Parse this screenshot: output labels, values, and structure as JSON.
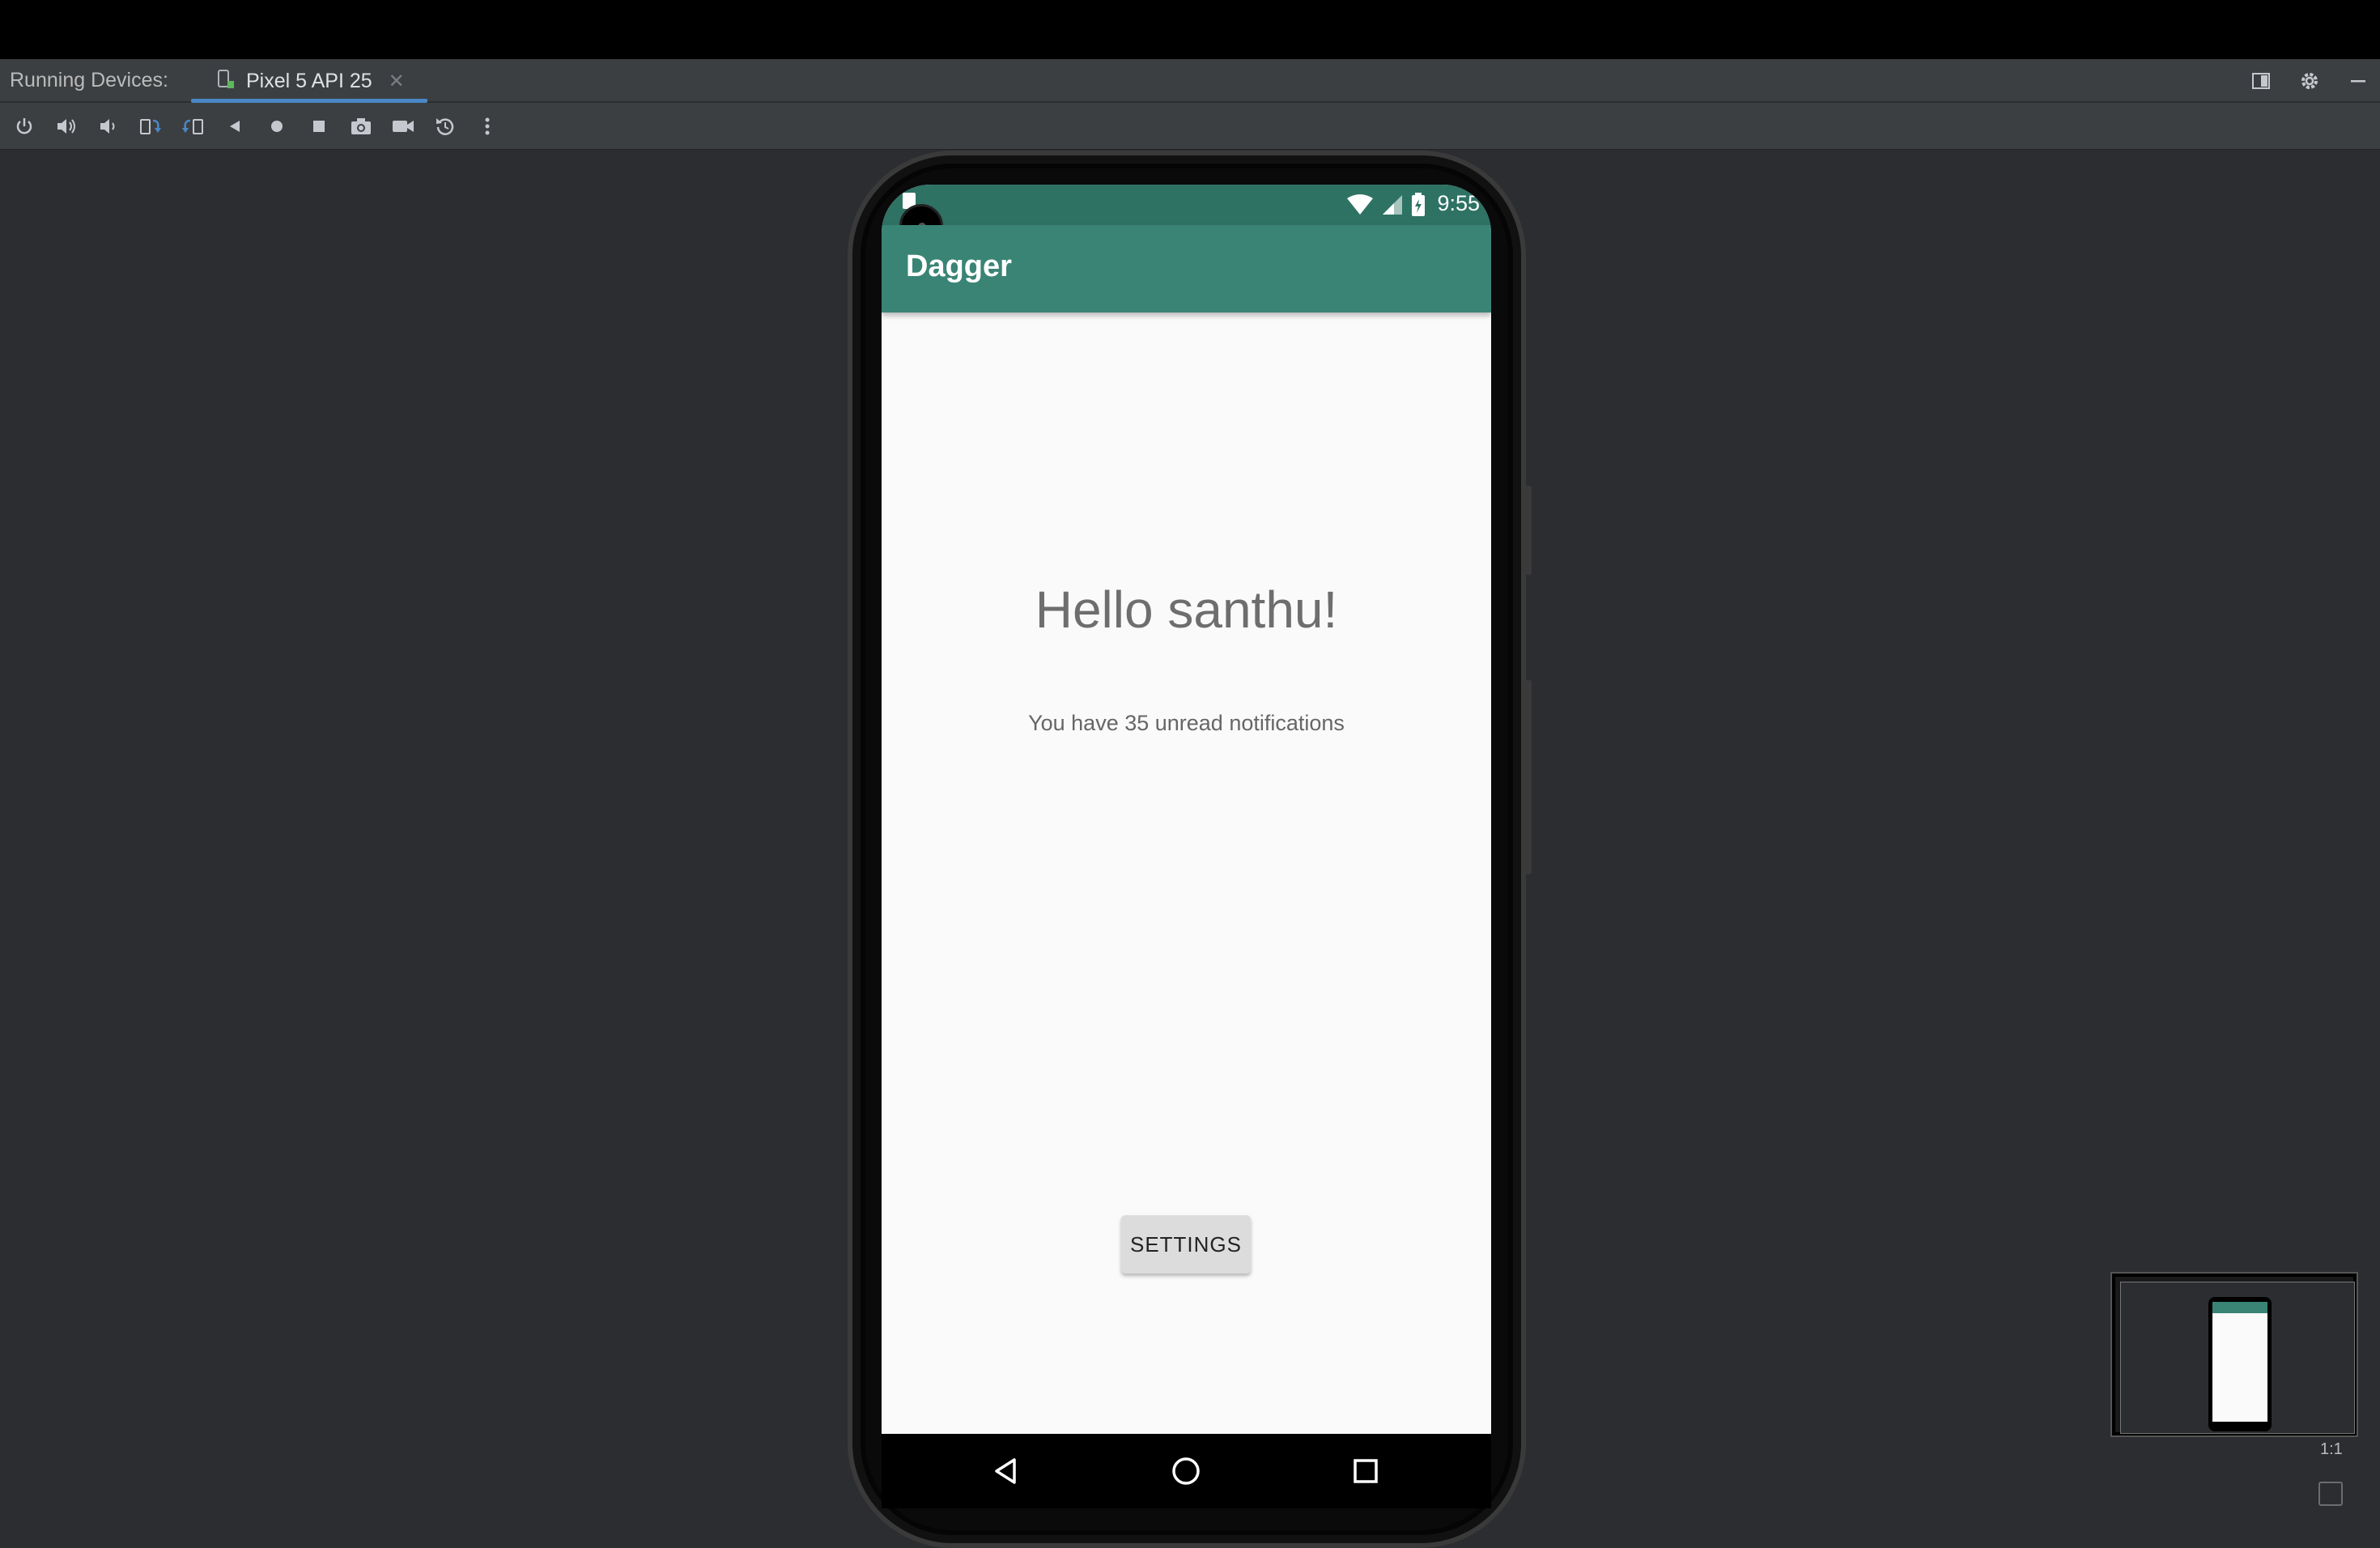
{
  "tool_window": {
    "label": "Running Devices:",
    "tab": {
      "label": "Pixel 5 API 25",
      "close_icon": "close-icon"
    },
    "right_icons": [
      "restore-layout-icon",
      "gear-icon",
      "minimize-icon"
    ]
  },
  "toolbar": {
    "icons": [
      "power-icon",
      "volume-up-icon",
      "volume-down-icon",
      "rotate-left-icon",
      "rotate-right-icon",
      "back-icon",
      "home-icon",
      "overview-icon",
      "screenshot-icon",
      "screen-record-icon",
      "reset-icon",
      "more-icon"
    ]
  },
  "device": {
    "status_time": "9:55",
    "app_title": "Dagger",
    "greeting": "Hello santhu!",
    "notifications_text": "You have 35 unread notifications",
    "settings_button": "SETTINGS"
  },
  "minimap": {
    "zoom_label": "1:1"
  },
  "colors": {
    "accent_tab": "#4a88c7",
    "app_bar": "#3a8476",
    "status_bar": "#2e7264",
    "background": "#2b2d30"
  }
}
